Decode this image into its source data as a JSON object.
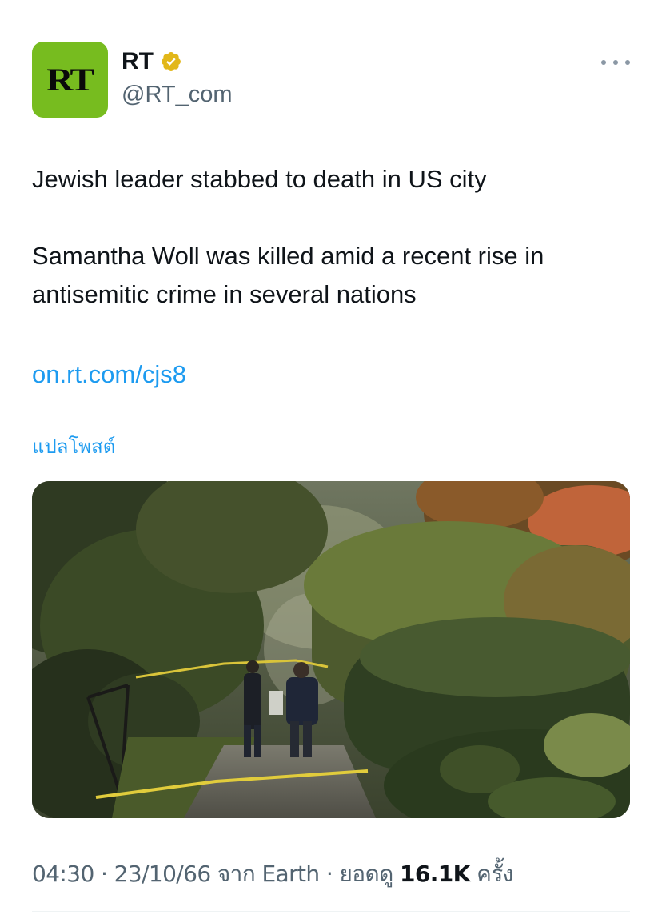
{
  "author": {
    "avatar_text": "RT",
    "display_name": "RT",
    "verified_badge": "gold-verified-badge-icon",
    "handle": "@RT_com"
  },
  "more_icon": "more-horizontal-icon",
  "tweet": {
    "headline": "Jewish leader stabbed to death in US city",
    "body": "Samantha Woll was killed amid a recent rise in antisemitic crime in several nations",
    "link": "on.rt.com/cjs8",
    "translate_label": "แปลโพสต์"
  },
  "media": {
    "kind": "photo"
  },
  "meta": {
    "time": "04:30",
    "sep1": " · ",
    "date": "23/10/66",
    "source_prefix": " จาก ",
    "source": "Earth",
    "sep2": " · ",
    "views_label": "ยอดดู ",
    "views_count": "16.1K",
    "views_suffix": " ครั้ง"
  },
  "colors": {
    "avatar_bg": "#77bc1f",
    "link": "#1d9bf0",
    "secondary_text": "#536471",
    "badge_gold": "#e2b719"
  }
}
